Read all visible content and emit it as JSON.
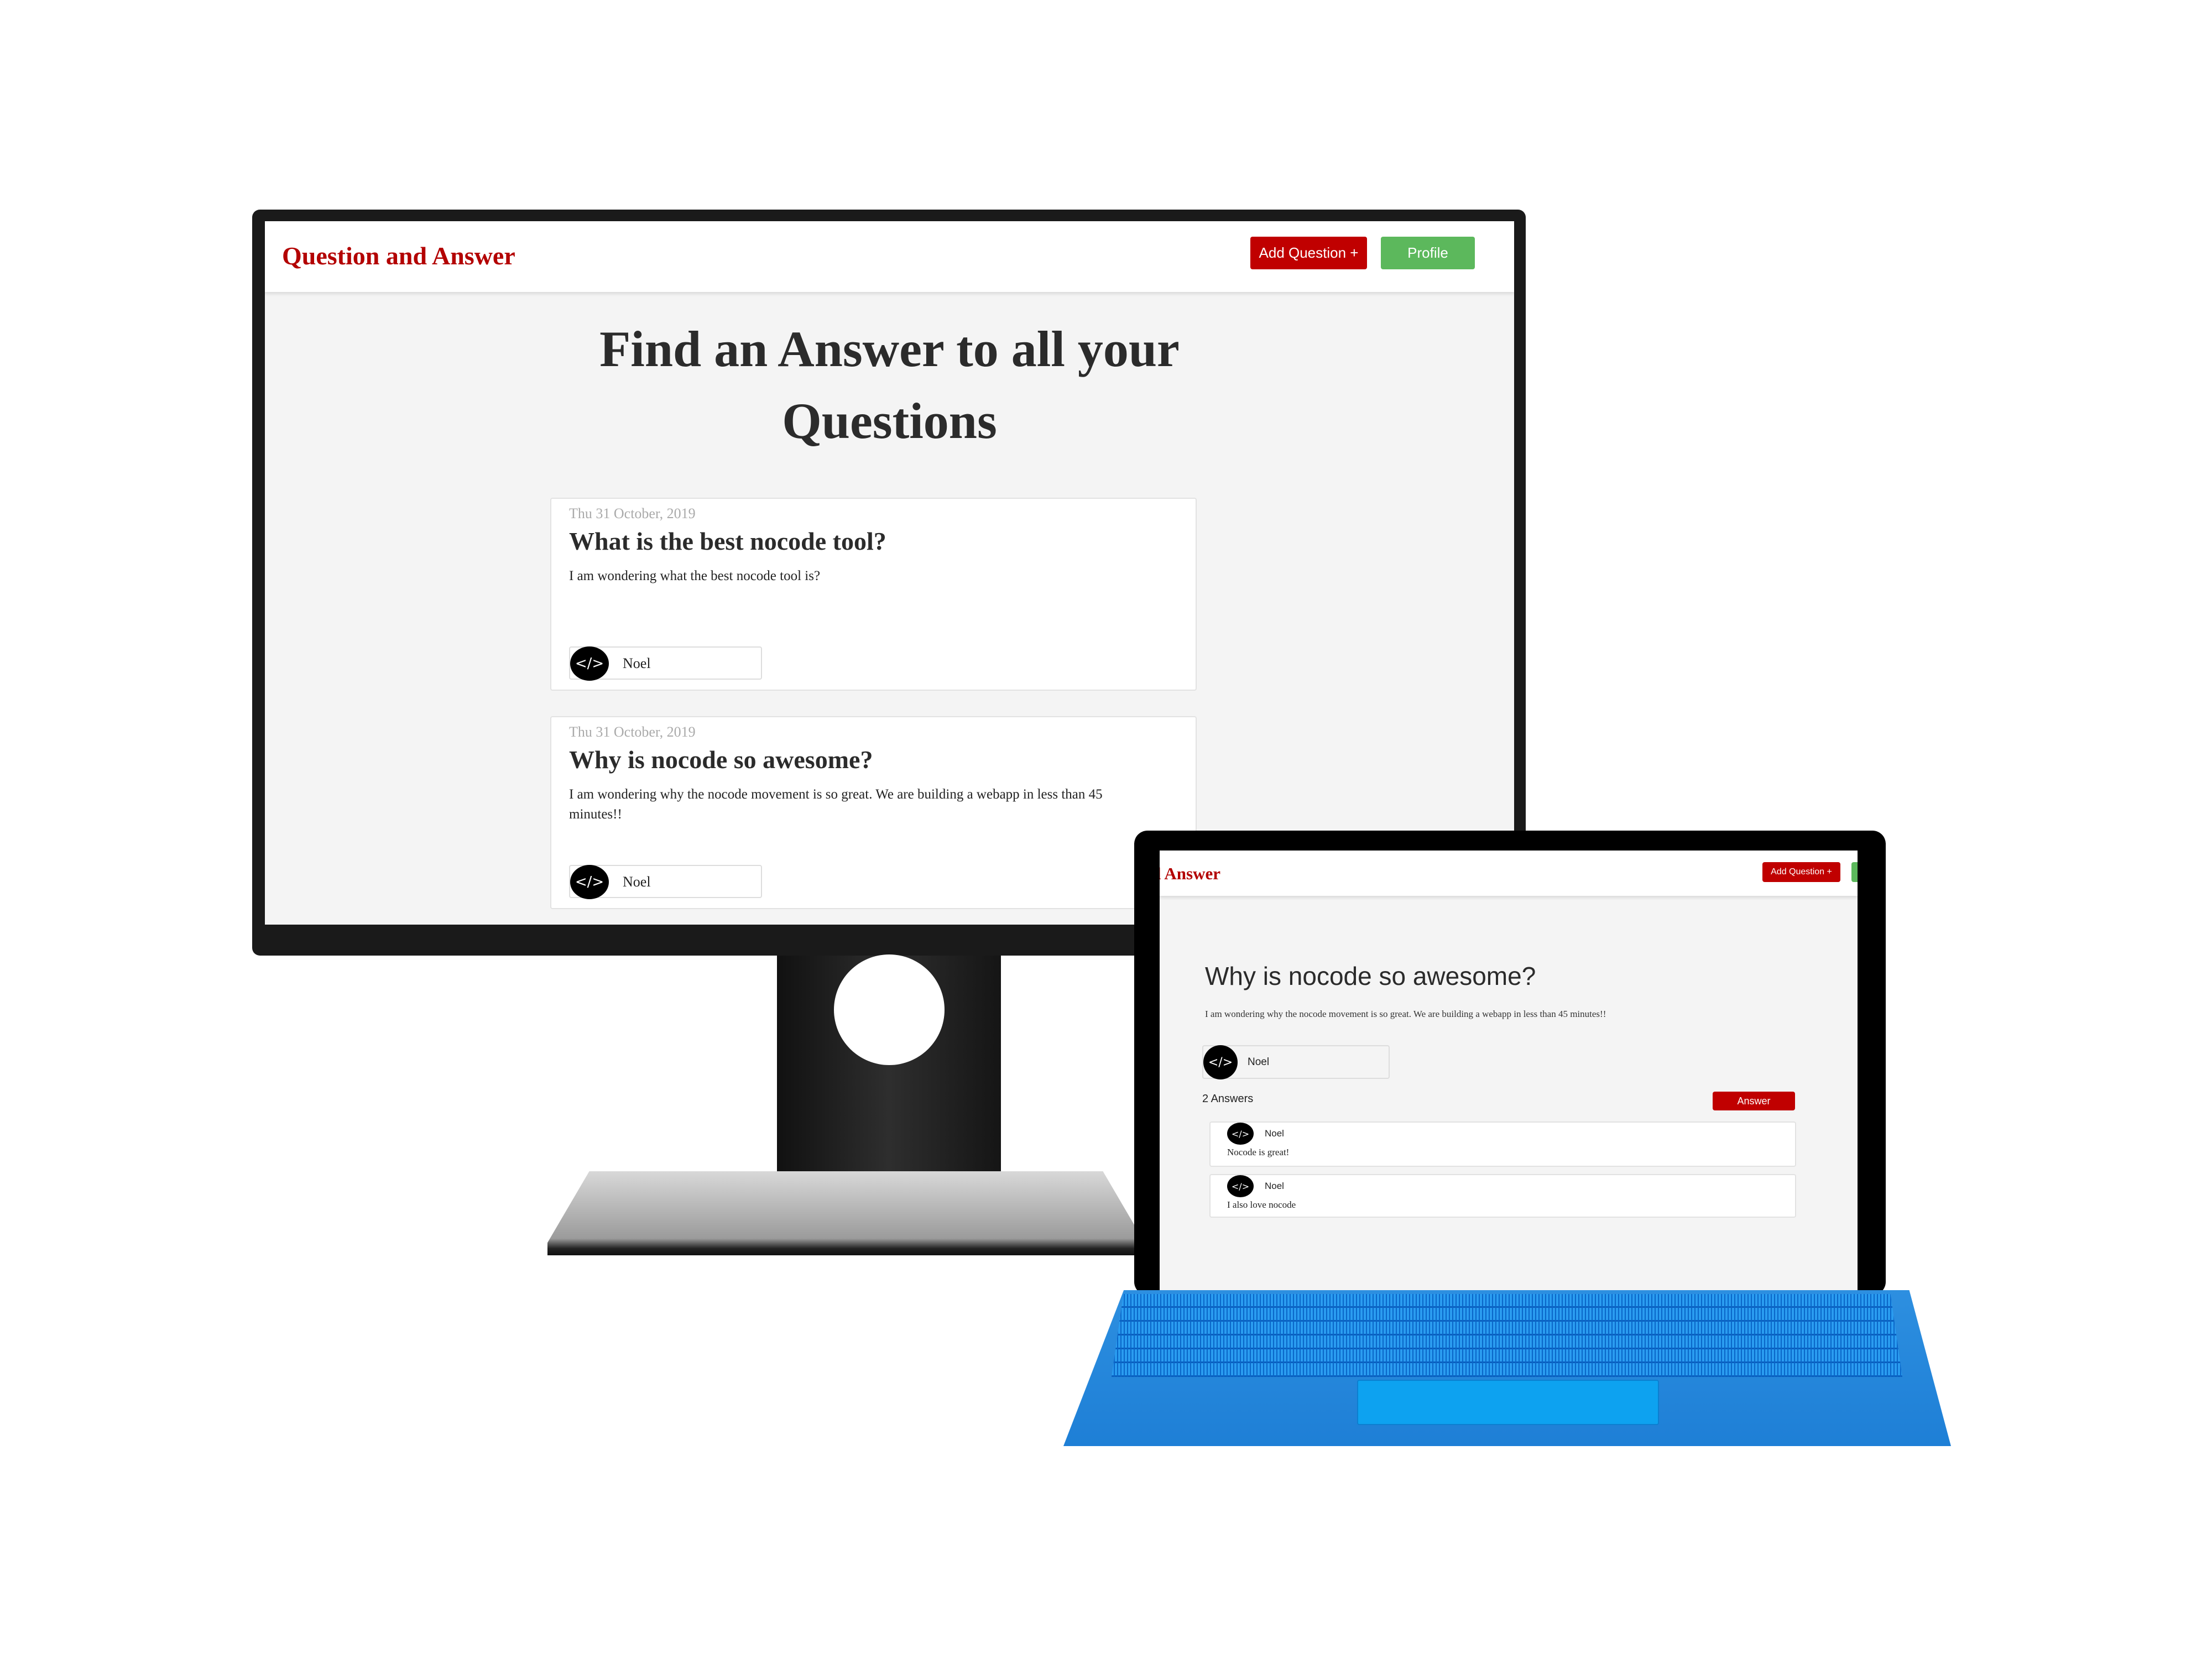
{
  "app": {
    "title": "Question and Answer",
    "add_question_label": "Add Question +",
    "profile_label": "Profile"
  },
  "colors": {
    "brand": "#b30000",
    "primary_button": "#c00000",
    "profile_button": "#5cb85c",
    "keyboard": "#1e7fd6"
  },
  "home": {
    "hero_line1": "Find an Answer to all your",
    "hero_line2": "Questions",
    "questions": [
      {
        "date": "Thu 31 October, 2019",
        "title": "What is the best nocode tool?",
        "body": "I am wondering what the best nocode tool is?",
        "author": "Noel",
        "avatar_icon": "code-icon"
      },
      {
        "date": "Thu 31 October, 2019",
        "title": "Why is nocode so awesome?",
        "body": "I am wondering why the nocode movement is so great. We are building a webapp in less than 45 minutes!!",
        "author": "Noel",
        "avatar_icon": "code-icon"
      }
    ]
  },
  "detail": {
    "title": "Why is nocode so awesome?",
    "body": "I am wondering why the nocode movement is so great. We are building a webapp in less than 45 minutes!!",
    "author": "Noel",
    "answers_count": "2 Answers",
    "answer_button": "Answer",
    "answers": [
      {
        "author": "Noel",
        "text": "Nocode is great!"
      },
      {
        "author": "Noel",
        "text": "I also love nocode"
      }
    ]
  },
  "icons": {
    "avatar": "</>"
  }
}
